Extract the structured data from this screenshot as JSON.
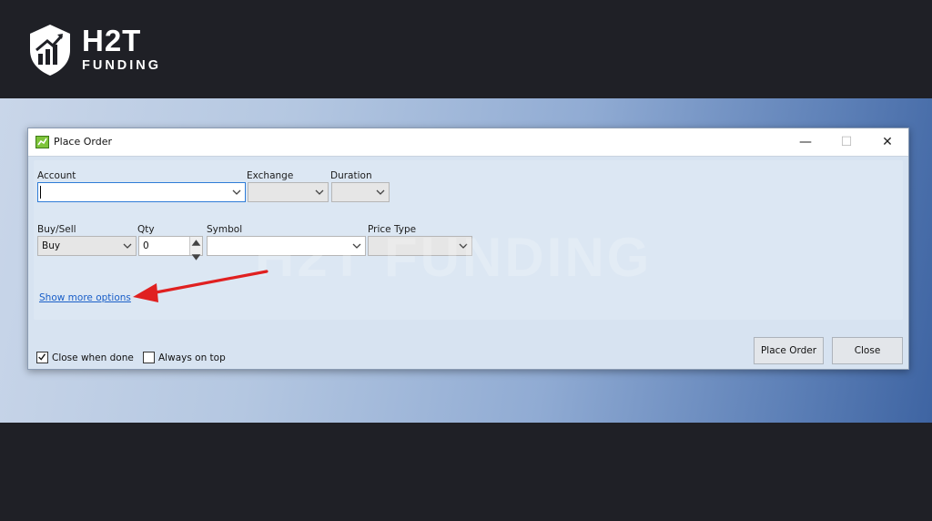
{
  "brand": {
    "name": "H2T",
    "sub": "FUNDING",
    "watermark": "H2T FUNDING"
  },
  "window": {
    "title": "Place Order",
    "controls": {
      "minimize": "—",
      "maximize": "☐",
      "close": "✕"
    }
  },
  "form": {
    "account": {
      "label": "Account",
      "value": ""
    },
    "exchange": {
      "label": "Exchange",
      "value": ""
    },
    "duration": {
      "label": "Duration",
      "value": ""
    },
    "buy_sell": {
      "label": "Buy/Sell",
      "value": "Buy"
    },
    "qty": {
      "label": "Qty",
      "value": "0"
    },
    "symbol": {
      "label": "Symbol",
      "value": ""
    },
    "price_type": {
      "label": "Price Type",
      "value": ""
    }
  },
  "more_options_link": "Show more options",
  "checkboxes": {
    "close_when_done": {
      "label": "Close when done",
      "checked": true
    },
    "always_on_top": {
      "label": "Always on top",
      "checked": false
    }
  },
  "buttons": {
    "place_order": "Place Order",
    "close": "Close"
  },
  "colors": {
    "link": "#1a5fc8",
    "annotation_arrow": "#e02020",
    "focus_border": "#2f7cd7"
  }
}
